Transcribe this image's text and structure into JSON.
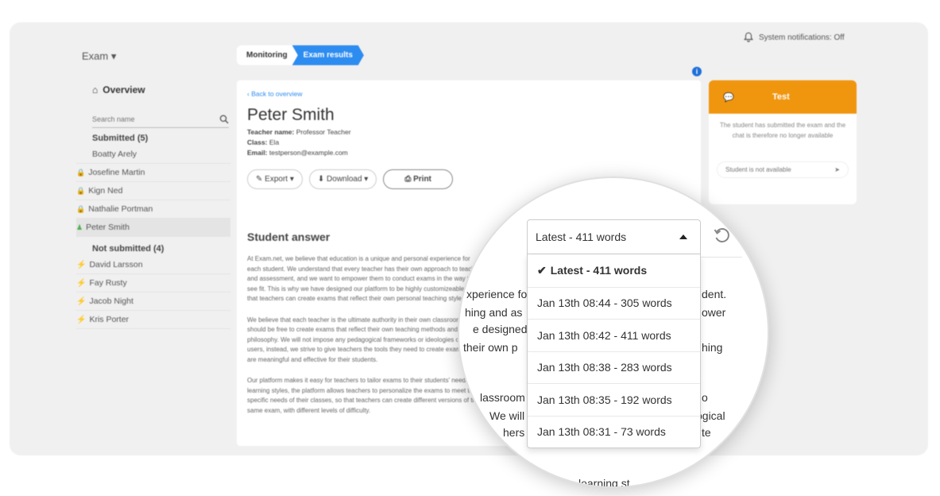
{
  "notifications": {
    "label": "System notifications: Off"
  },
  "exam_menu": {
    "label": "Exam ▾"
  },
  "sidebar": {
    "overview": "Overview",
    "search_placeholder": "Search name",
    "submitted_header": "Submitted (5)",
    "submitted": [
      {
        "name": "Boatty Arely",
        "icon": "none"
      },
      {
        "name": "Josefine Martin",
        "icon": "lock"
      },
      {
        "name": "Kign Ned",
        "icon": "lock"
      },
      {
        "name": "Nathalie Portman",
        "icon": "lock"
      },
      {
        "name": "Peter Smith",
        "icon": "person",
        "active": true
      }
    ],
    "not_submitted_header": "Not submitted (4)",
    "not_submitted": [
      {
        "name": "David Larsson",
        "icon": "bolt"
      },
      {
        "name": "Fay Rusty",
        "icon": "bolt"
      },
      {
        "name": "Jacob Night",
        "icon": "bolt"
      },
      {
        "name": "Kris Porter",
        "icon": "bolt"
      }
    ]
  },
  "breadcrumb": {
    "monitoring": "Monitoring",
    "results": "Exam results"
  },
  "main": {
    "back": "Back to overview",
    "student_name": "Peter Smith",
    "teacher_label": "Teacher name:",
    "teacher_value": "Professor Teacher",
    "class_label": "Class:",
    "class_value": "Ela",
    "email_label": "Email:",
    "email_value": "testperson@example.com",
    "buttons": {
      "export": "Export ▾",
      "download": "Download ▾",
      "print": "Print"
    },
    "answer_title": "Student answer",
    "para1": "At Exam.net, we believe that education is a unique and personal experience for each student. We understand that every teacher has their own approach to teaching and assessment, and we want to empower them to conduct exams in the way they see fit. This is why we have designed our platform to be highly customizeable, so that teachers can create exams that reflect their own personal teaching style.",
    "para2": "We believe that each teacher is the ultimate authority in their own classroom and should be free to create exams that reflect their own teaching methods and philosophy. We will not impose any pedagogical frameworks or ideologies on our users, instead, we strive to give teachers the tools they need to create exams that are meaningful and effective for their students.",
    "para3": "Our platform makes it easy for teachers to tailor exams to their students' needs and learning styles, the platform allows teachers to personalize the exams to meet the specific needs of their classes, so that teachers can create different versions of the same exam, with different levels of difficulty."
  },
  "chat": {
    "title": "Test",
    "message": "The student has submitted the exam and the chat is therefore no longer available",
    "input": "Student is not available"
  },
  "magnifier": {
    "fragments": [
      "xperience fo",
      "dent.",
      "hing and as",
      "ower",
      "e designed",
      "their own p",
      "hing",
      "lassroom",
      "o",
      "We will",
      "ogical",
      "hers",
      "te",
      "learning st"
    ],
    "select_value": "Latest - 411 words",
    "options": [
      "Latest - 411 words",
      "Jan 13th 08:44 - 305 words",
      "Jan 13th 08:42 - 411 words",
      "Jan 13th 08:38 - 283 words",
      "Jan 13th 08:35 - 192 words",
      "Jan 13th 08:31 - 73 words"
    ]
  }
}
